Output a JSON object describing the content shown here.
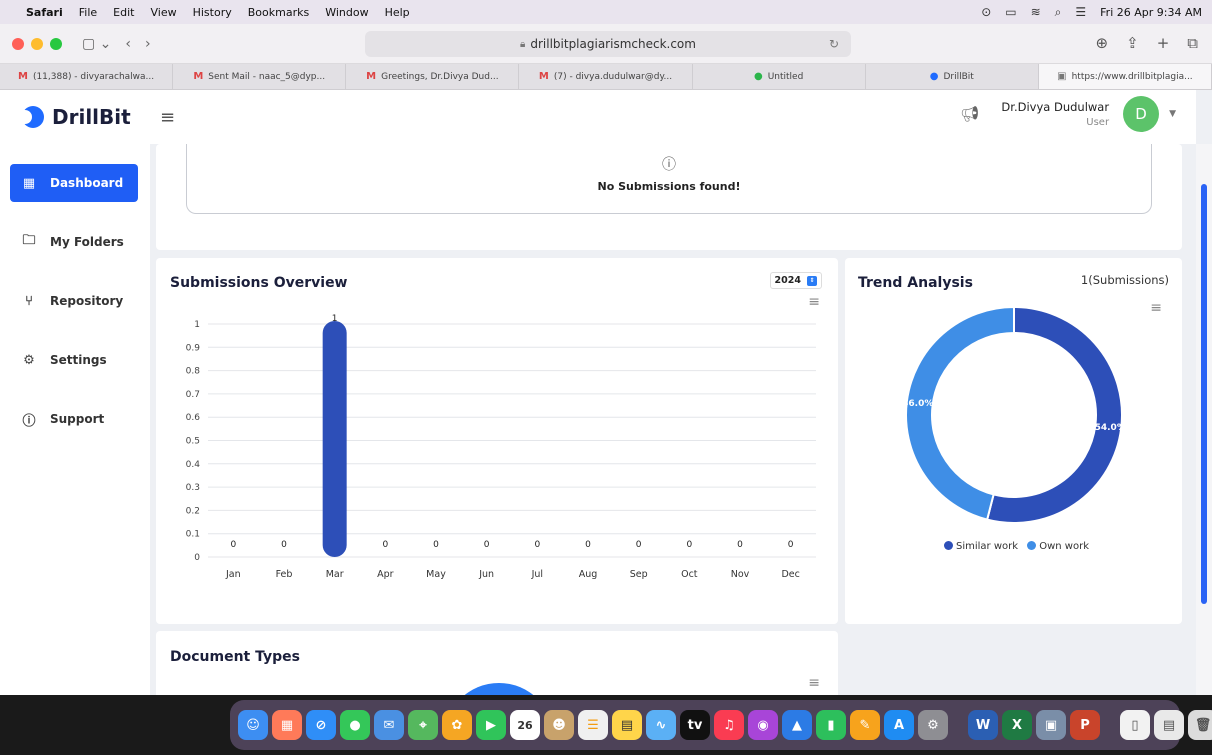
{
  "menubar": {
    "app": "Safari",
    "items": [
      "File",
      "Edit",
      "View",
      "History",
      "Bookmarks",
      "Window",
      "Help"
    ],
    "clock": "Fri 26 Apr 9:34 AM"
  },
  "browser": {
    "url": "drillbitplagiarismcheck.com",
    "tabs": [
      {
        "label": "(11,388) - divyarachalwa..."
      },
      {
        "label": "Sent Mail - naac_5@dyp..."
      },
      {
        "label": "Greetings, Dr.Divya Dud..."
      },
      {
        "label": "(7) - divya.dudulwar@dy..."
      },
      {
        "label": "Untitled"
      },
      {
        "label": "DrillBit"
      },
      {
        "label": "https://www.drillbitplagia..."
      }
    ]
  },
  "app": {
    "brand": "DrillBit",
    "user_name": "Dr.Divya Dudulwar",
    "user_role": "User",
    "avatar_letter": "D",
    "nav": [
      {
        "label": "Dashboard",
        "icon": "dashboard-grid-icon"
      },
      {
        "label": "My Folders",
        "icon": "folder-icon"
      },
      {
        "label": "Repository",
        "icon": "repository-icon"
      },
      {
        "label": "Settings",
        "icon": "gear-icon"
      },
      {
        "label": "Support",
        "icon": "help-icon"
      }
    ]
  },
  "submissions_box": {
    "message": "No Submissions found!"
  },
  "overview": {
    "title": "Submissions Overview",
    "year": "2024"
  },
  "trend": {
    "title": "Trend Analysis",
    "count_label": "1(Submissions)"
  },
  "doc_types": {
    "title": "Document Types"
  },
  "chart_data": [
    {
      "type": "bar",
      "title": "Submissions Overview",
      "categories": [
        "Jan",
        "Feb",
        "Mar",
        "Apr",
        "May",
        "Jun",
        "Jul",
        "Aug",
        "Sep",
        "Oct",
        "Nov",
        "Dec"
      ],
      "values": [
        0,
        0,
        1,
        0,
        0,
        0,
        0,
        0,
        0,
        0,
        0,
        0
      ],
      "ylim": [
        0,
        1
      ],
      "yticks": [
        "0",
        "0.1",
        "0.2",
        "0.3",
        "0.4",
        "0.5",
        "0.6",
        "0.7",
        "0.8",
        "0.9",
        "1"
      ],
      "color": "#2d4fb8",
      "grid": true
    },
    {
      "type": "pie",
      "title": "Trend Analysis",
      "donut": true,
      "slices": [
        {
          "name": "Similar work",
          "value": 54.0,
          "label": "54.0%",
          "color": "#2d4fb8"
        },
        {
          "name": "Own work",
          "value": 46.0,
          "label": "46.0%",
          "color": "#3f8ee6"
        }
      ],
      "legend": "bottom"
    }
  ]
}
